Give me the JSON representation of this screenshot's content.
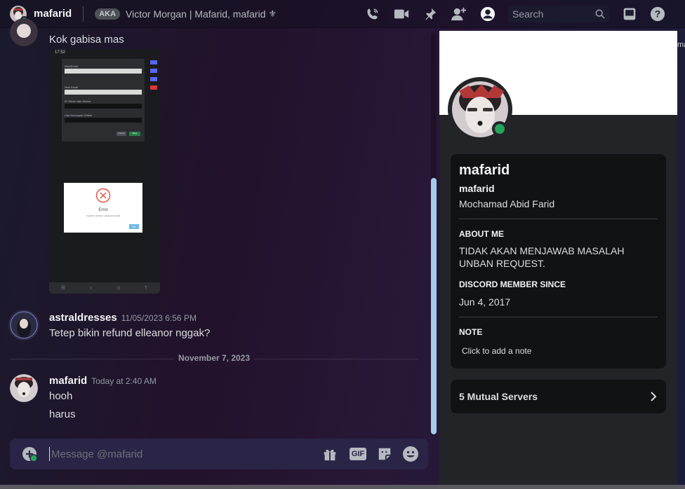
{
  "header": {
    "name": "mafarid",
    "aka_badge": "AKA",
    "aka_names": "Victor Morgan | Mafarid, mafarid",
    "search_placeholder": "Search",
    "icons": [
      "voice-call-icon",
      "video-call-icon",
      "pin-icon",
      "add-friend-icon",
      "profile-toggle-icon",
      "search-icon",
      "inbox-icon",
      "help-icon"
    ]
  },
  "messages": {
    "first": {
      "text": "Kok gabisa mas"
    },
    "second": {
      "author": "astraldresses",
      "timestamp": "11/05/2023 6:56 PM",
      "text": "Tetep bikin refund elleanor nggak?"
    },
    "date_divider": "November 7, 2023",
    "third": {
      "author": "mafarid",
      "timestamp": "Today at 2:40 AM",
      "lines": [
        "hooh",
        "harus"
      ]
    }
  },
  "screenshot_attachment": {
    "status_time": "17:52",
    "dialog_title": "Error",
    "dialog_text": "Captcha / identity / password invalid",
    "dialog_button": "OK",
    "fields": [
      "Nick/Email",
      "New Email",
      "ID Steam dan Nomor",
      "Cari Kelompok Online"
    ],
    "buttons": [
      "Cancel",
      "Save"
    ]
  },
  "composer": {
    "placeholder": "Message @mafarid",
    "gif_label": "GIF"
  },
  "profile": {
    "display_name": "mafarid",
    "username": "mafarid",
    "pronouns": "Mochamad Abid Farid",
    "about_title": "ABOUT ME",
    "about_text": "TIDAK AKAN MENJAWAB MASALAH UNBAN REQUEST.",
    "member_since_title": "DISCORD MEMBER SINCE",
    "member_since": "Jun 4, 2017",
    "note_title": "NOTE",
    "note_placeholder": "Click to add a note",
    "mutual_servers": "5 Mutual Servers"
  },
  "edge_text": "ma",
  "colors": {
    "online": "#23a55a",
    "scroll_thumb": "#a4ccea",
    "composer_bg": "#2a2547",
    "panel_bg": "#232428",
    "card_bg": "#111214"
  }
}
